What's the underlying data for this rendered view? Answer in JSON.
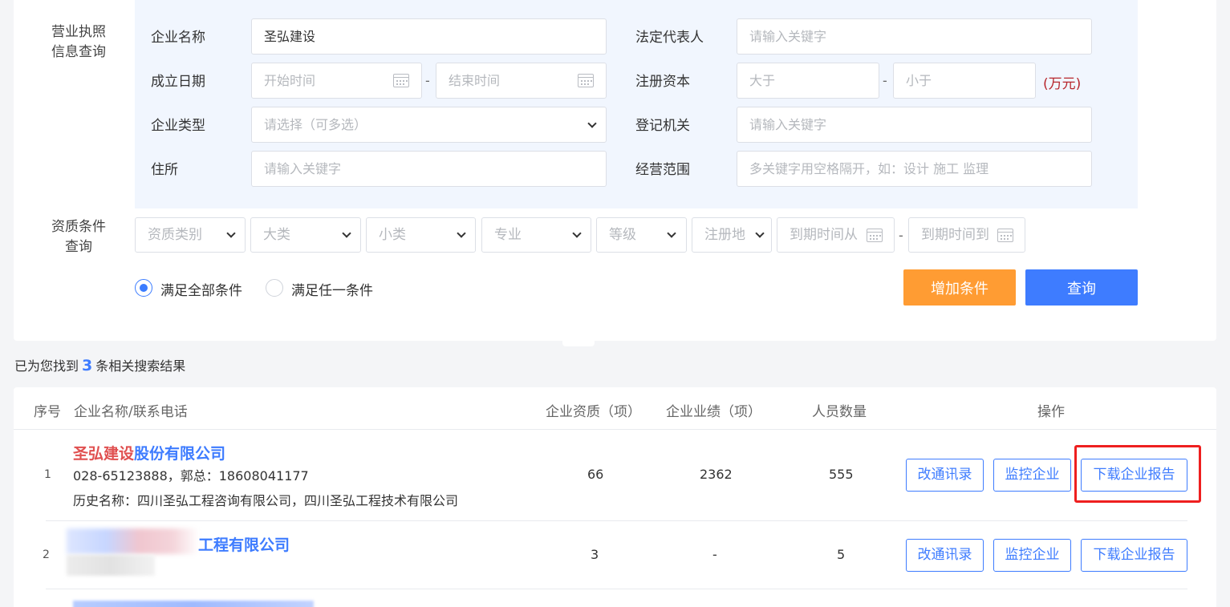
{
  "license_query": {
    "section_label_line1": "营业执照",
    "section_label_line2": "信息查询",
    "company_name": {
      "label": "企业名称",
      "value": "圣弘建设"
    },
    "legal_rep": {
      "label": "法定代表人",
      "placeholder": "请输入关键字"
    },
    "founded": {
      "label": "成立日期",
      "start_placeholder": "开始时间",
      "end_placeholder": "结束时间",
      "separator": "-"
    },
    "capital": {
      "label": "注册资本",
      "min_placeholder": "大于",
      "max_placeholder": "小于",
      "separator": "-",
      "unit": "(万元)"
    },
    "company_type": {
      "label": "企业类型",
      "placeholder": "请选择（可多选）"
    },
    "registrar": {
      "label": "登记机关",
      "placeholder": "请输入关键字"
    },
    "address": {
      "label": "住所",
      "placeholder": "请输入关键字"
    },
    "business_scope": {
      "label": "经营范围",
      "placeholder": "多关键字用空格隔开，如：设计 施工 监理"
    }
  },
  "qualification_query": {
    "section_label_line1": "资质条件",
    "section_label_line2": "查询",
    "selects": [
      "资质类别",
      "大类",
      "小类",
      "专业",
      "等级",
      "注册地"
    ],
    "expire_from": "到期时间从",
    "expire_to": "到期时间到",
    "separator": "-"
  },
  "match_mode": {
    "all": "满足全部条件",
    "any": "满足任一条件",
    "selected": "all"
  },
  "buttons": {
    "add_condition": "增加条件",
    "query": "查询"
  },
  "summary": {
    "prefix": "已为您找到",
    "count": "3",
    "suffix": "条相关搜索结果"
  },
  "table": {
    "headers": {
      "index": "序号",
      "name": "企业名称/联系电话",
      "qualifications": "企业资质（项）",
      "performance": "企业业绩（项）",
      "staff": "人员数量",
      "actions": "操作"
    },
    "rows": [
      {
        "index": "1",
        "name_highlight": "圣弘建设",
        "name_rest": "股份有限公司",
        "phone": "028-65123888，郭总：18608041177",
        "history": "历史名称：四川圣弘工程咨询有限公司，四川圣弘工程技术有限公司",
        "qualifications": "66",
        "performance": "2362",
        "staff": "555"
      },
      {
        "index": "2",
        "name_rest": "工程有限公司",
        "qualifications": "3",
        "performance": "-",
        "staff": "5"
      }
    ],
    "actions": {
      "contact": "改通讯录",
      "monitor": "监控企业",
      "report": "下载企业报告"
    }
  },
  "colors": {
    "accent": "#3e7cff",
    "orange": "#ff9c33",
    "highlight_red": "#e05050",
    "annotation_red": "#ee1f1f"
  }
}
